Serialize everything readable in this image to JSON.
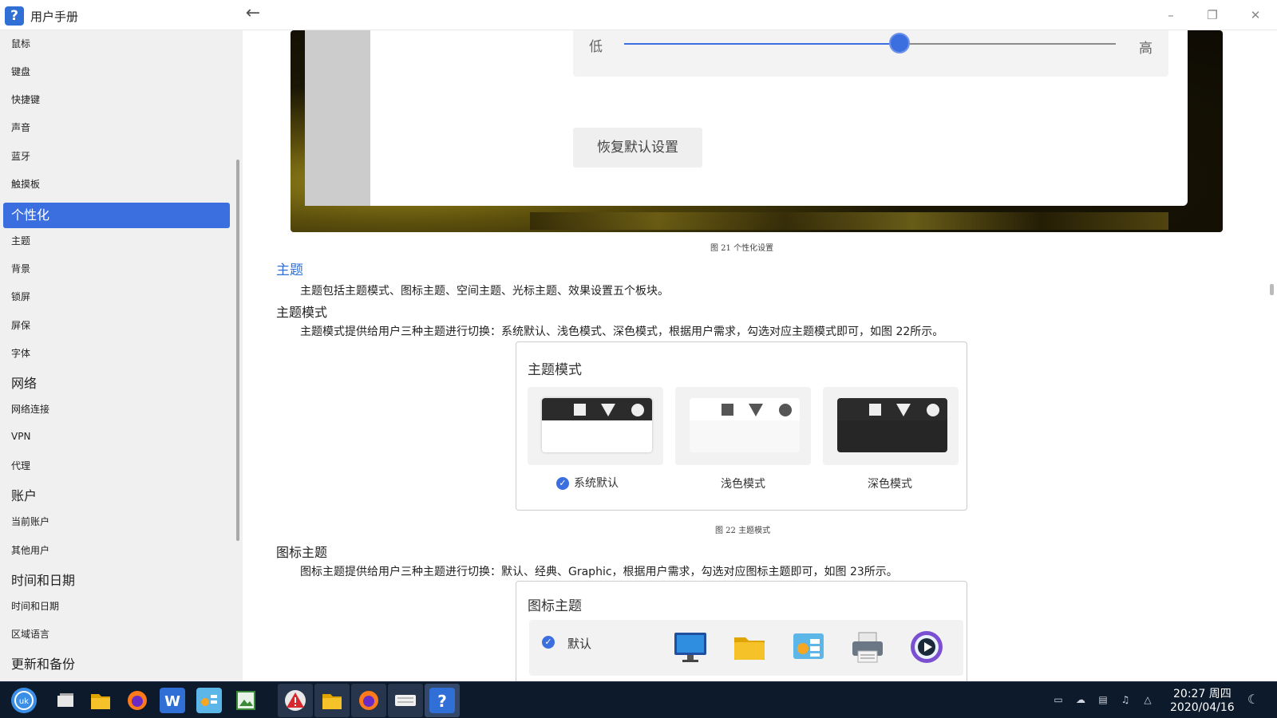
{
  "window": {
    "title": "用户手册",
    "app_icon_glyph": "?",
    "back_icon": "arrow-left-icon",
    "minimize_glyph": "–",
    "restore_glyph": "❐",
    "close_glyph": "✕"
  },
  "sidebar": {
    "items": [
      {
        "label": "鼠标",
        "kind": "item"
      },
      {
        "label": "键盘",
        "kind": "item"
      },
      {
        "label": "快捷键",
        "kind": "item"
      },
      {
        "label": "声音",
        "kind": "item"
      },
      {
        "label": "蓝牙",
        "kind": "item"
      },
      {
        "label": "触摸板",
        "kind": "item"
      },
      {
        "label": "个性化",
        "kind": "section-active"
      },
      {
        "label": "主题",
        "kind": "item"
      },
      {
        "label": "背景",
        "kind": "item"
      },
      {
        "label": "锁屏",
        "kind": "item"
      },
      {
        "label": "屏保",
        "kind": "item"
      },
      {
        "label": "字体",
        "kind": "item"
      },
      {
        "label": "网络",
        "kind": "section"
      },
      {
        "label": "网络连接",
        "kind": "item"
      },
      {
        "label": "VPN",
        "kind": "item"
      },
      {
        "label": "代理",
        "kind": "item"
      },
      {
        "label": "账户",
        "kind": "section"
      },
      {
        "label": "当前账户",
        "kind": "item"
      },
      {
        "label": "其他用户",
        "kind": "item"
      },
      {
        "label": "时间和日期",
        "kind": "section"
      },
      {
        "label": "时间和日期",
        "kind": "item"
      },
      {
        "label": "区域语言",
        "kind": "item"
      },
      {
        "label": "更新和备份",
        "kind": "section"
      }
    ]
  },
  "content": {
    "screenshot": {
      "slider_low": "低",
      "slider_high": "高",
      "slider_value": 0.56,
      "reset_button": "恢复默认设置",
      "accent": "#3b6fe0"
    },
    "fig21_caption": "图 21 个性化设置",
    "theme_heading": "主题",
    "theme_intro": "主题包括主题模式、图标主题、空间主题、光标主题、效果设置五个板块。",
    "theme_mode_heading": "主题模式",
    "theme_mode_text": "主题模式提供给用户三种主题进行切换：系统默认、浅色模式、深色模式，根据用户需求，勾选对应主题模式即可，如图 22所示。",
    "theme_mode_figure": {
      "title": "主题模式",
      "options": [
        {
          "label": "系统默认",
          "selected": true
        },
        {
          "label": "浅色模式",
          "selected": false
        },
        {
          "label": "深色模式",
          "selected": false
        }
      ]
    },
    "fig22_caption": "图 22 主题模式",
    "icon_theme_heading": "图标主题",
    "icon_theme_text": "图标主题提供给用户三种主题进行切换：默认、经典、Graphic，根据用户需求，勾选对应图标主题即可，如图 23所示。",
    "icon_theme_figure": {
      "title": "图标主题",
      "row_label": "默认",
      "selected": true,
      "icons": [
        "monitor-icon",
        "folder-icon",
        "system-settings-icon",
        "printer-icon",
        "media-player-icon"
      ]
    }
  },
  "taskbar": {
    "apps": [
      "start-menu-icon",
      "multitask-view-icon",
      "file-manager-icon",
      "firefox-icon",
      "wps-writer-icon",
      "control-panel-icon",
      "image-viewer-icon",
      "warning-app-icon",
      "file-manager-icon",
      "firefox-icon",
      "keyboard-app-icon",
      "user-manual-icon"
    ],
    "tray": [
      "message-icon",
      "cloud-icon",
      "network-icon",
      "volume-icon",
      "input-method-icon"
    ],
    "time": "20:27 周四",
    "date": "2020/04/16",
    "night_mode_icon": "moon-icon"
  }
}
